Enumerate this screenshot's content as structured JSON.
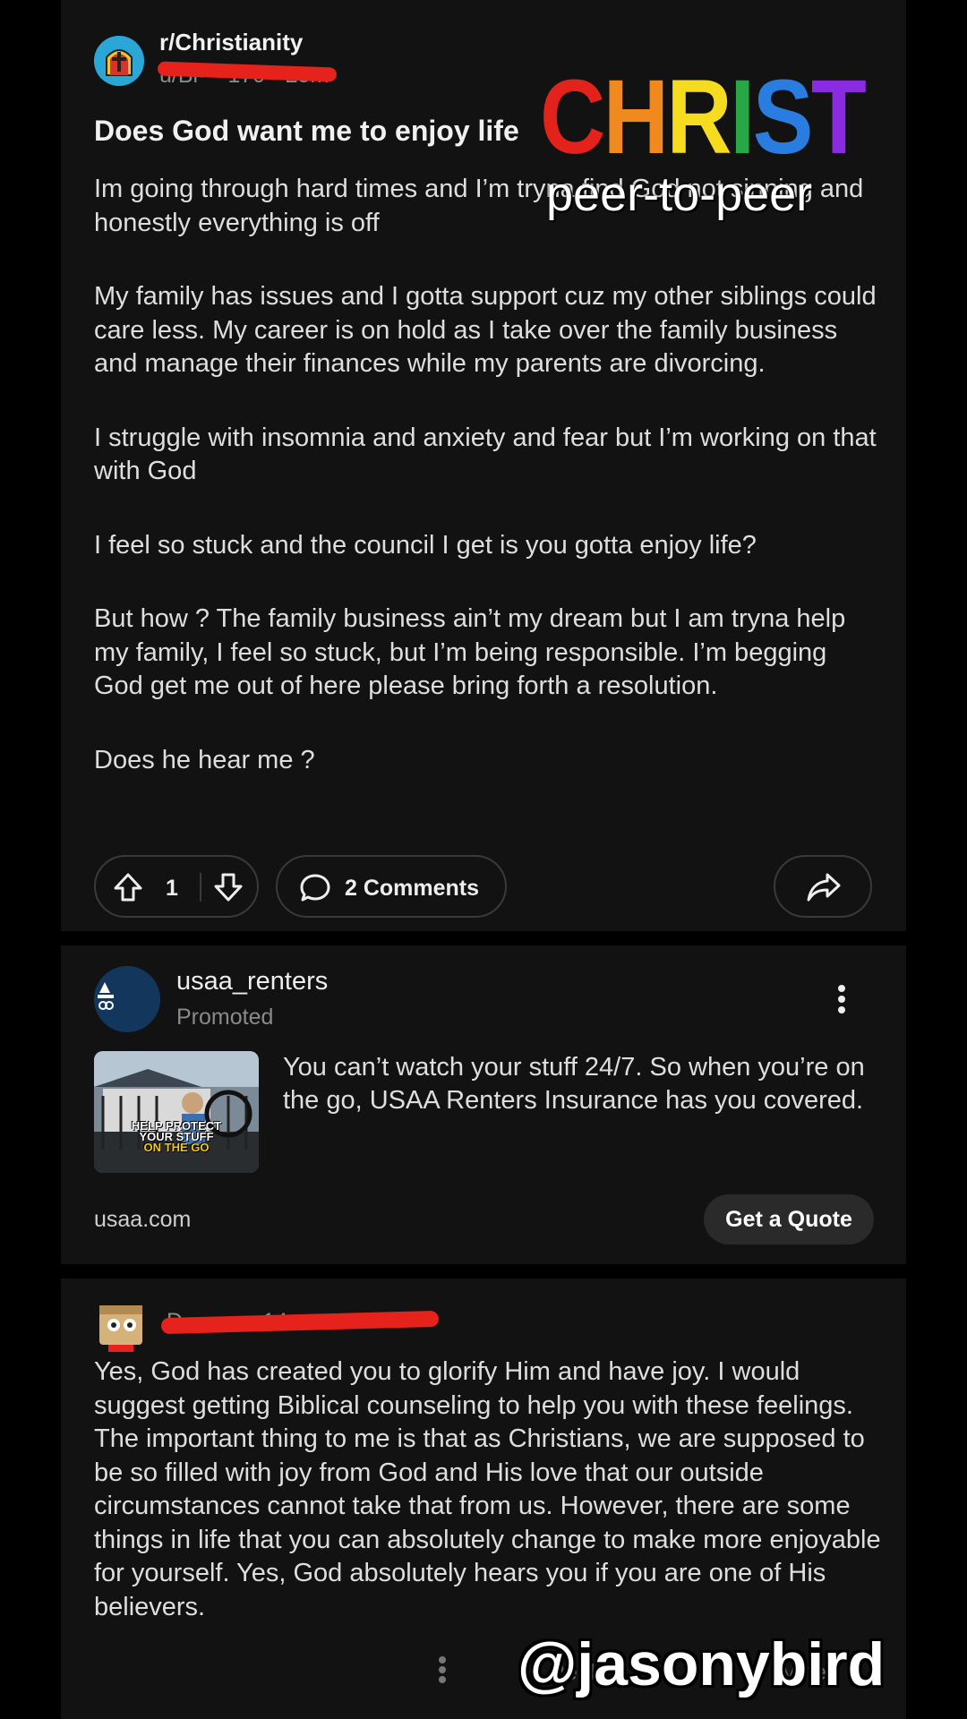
{
  "post": {
    "subreddit": "r/Christianity",
    "meta": "u/Bi····170 • 25m",
    "title": "Does God want me to enjoy life",
    "body": [
      "Im going through hard times and I’m tryna find God not sinning and honestly everything is off",
      "My family has issues and I gotta support cuz my other siblings  could care less. My career is on hold as I take over the family business and manage their finances while my parents are divorcing.",
      "I struggle with insomnia and anxiety and fear but I’m working on that with God",
      "I feel so stuck and the council I get is you gotta enjoy life?",
      "But how ? The family business ain’t my dream but I am tryna help my family, I feel so stuck, but I’m being responsible. I’m begging God get me out of here please bring forth a resolution.",
      "Does he hear me ?"
    ],
    "upvotes": "1",
    "comments_label": "2 Comments"
  },
  "ad": {
    "username": "usaa_renters",
    "promoted": "Promoted",
    "thumb_text": [
      "HELP PROTECT",
      "YOUR STUFF",
      "ON THE GO"
    ],
    "text": "You can’t watch your stuff 24/7. So when you’re on the go, USAA Renters Insurance has you covered.",
    "domain": "usaa.com",
    "cta": "Get a Quote"
  },
  "comment": {
    "meta": "D········ • 14m",
    "body": "Yes, God has created you to glorify Him and have joy. I would suggest getting Biblical counseling to help you with these feelings. The important thing to me is that as Christians, we are supposed to be so filled with joy from God and His love that our outside circumstances cannot take that from us. However, there are some things in life that you can absolutely change to make more enjoyable for yourself. Yes, God absolutely hears you if you are one of His believers.",
    "reply": "Reply",
    "vote": "Vote"
  },
  "overlay": {
    "title_letters": [
      {
        "ch": "C",
        "color": "#e3231b"
      },
      {
        "ch": "H",
        "color": "#f08a1e"
      },
      {
        "ch": "R",
        "color": "#f5dc1e"
      },
      {
        "ch": "I",
        "color": "#27a845"
      },
      {
        "ch": "S",
        "color": "#2a7de0"
      },
      {
        "ch": "T",
        "color": "#8a2be2"
      }
    ],
    "subtitle": "peer-to-peer",
    "watermark": "@jasonybird"
  },
  "colors": {
    "background": "#000000",
    "card": "#121212",
    "redaction": "#e5231c"
  }
}
